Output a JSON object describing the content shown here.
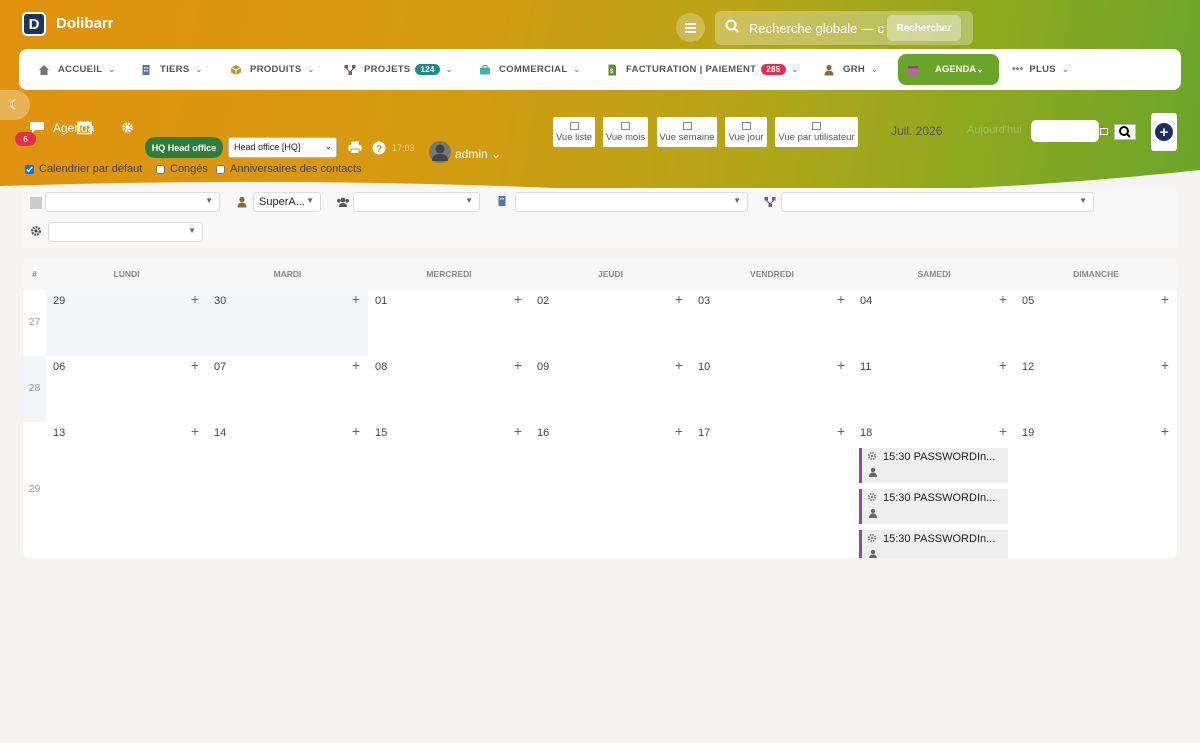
{
  "app": {
    "name": "Dolibarr",
    "logo_letter": "D"
  },
  "search": {
    "placeholder": "Recherche globale — c",
    "button": "Rechercher"
  },
  "topnav": [
    {
      "label": "ACCUEIL",
      "icon": "home-icon"
    },
    {
      "label": "TIERS",
      "icon": "building-icon"
    },
    {
      "label": "PRODUITS",
      "icon": "cube-icon"
    },
    {
      "label": "PROJETS",
      "icon": "project-icon",
      "badge": "124"
    },
    {
      "label": "COMMERCIAL",
      "icon": "briefcase-icon"
    },
    {
      "label": "FACTURATION | PAIEMENT",
      "icon": "invoice-icon",
      "badge": "285"
    },
    {
      "label": "GRH",
      "icon": "user-icon"
    },
    {
      "label": "AGENDA",
      "icon": "calendar-icon",
      "active": true
    },
    {
      "label": "PLUS",
      "icon": "more-icon"
    }
  ],
  "toolbar": {
    "notif_count": "6",
    "title": "Agenda",
    "hq_tag": "HQ Head office",
    "entity_select": "Head office [HQ]",
    "time": "17:03",
    "user": "admin",
    "views": [
      "Vue liste",
      "Vue mois",
      "Vue semaine",
      "Vue jour",
      "Vue par utilisateur"
    ],
    "current_period": "Juil. 2026",
    "today_label": "Aujourd'hui"
  },
  "checkboxes": [
    {
      "label": "Calendrier par défaut",
      "checked": true
    },
    {
      "label": "Congés",
      "checked": false
    },
    {
      "label": "Anniversaires des contacts",
      "checked": false
    }
  ],
  "filters": {
    "user_select": "SuperA..."
  },
  "calendar": {
    "headers": [
      "#",
      "LUNDI",
      "MARDI",
      "MERCREDI",
      "JEUDI",
      "VENDREDI",
      "SAMEDI",
      "DIMANCHE"
    ],
    "weeks": [
      {
        "num": "27",
        "days": [
          "29",
          "30",
          "01",
          "02",
          "03",
          "04",
          "05"
        ]
      },
      {
        "num": "28",
        "days": [
          "06",
          "07",
          "08",
          "09",
          "10",
          "11",
          "12"
        ]
      },
      {
        "num": "29",
        "days": [
          "13",
          "14",
          "15",
          "16",
          "17",
          "18",
          "19"
        ]
      }
    ],
    "events": [
      {
        "time_title": "15:30 PASSWORDIn..."
      },
      {
        "time_title": "15:30 PASSWORDIn..."
      },
      {
        "time_title": "15:30 PASSWORDIn..."
      }
    ]
  },
  "colors": {
    "accent": "#6aa52a",
    "brand": "#1d3557",
    "badge": "#e0304b",
    "event": "#8a4e93"
  }
}
